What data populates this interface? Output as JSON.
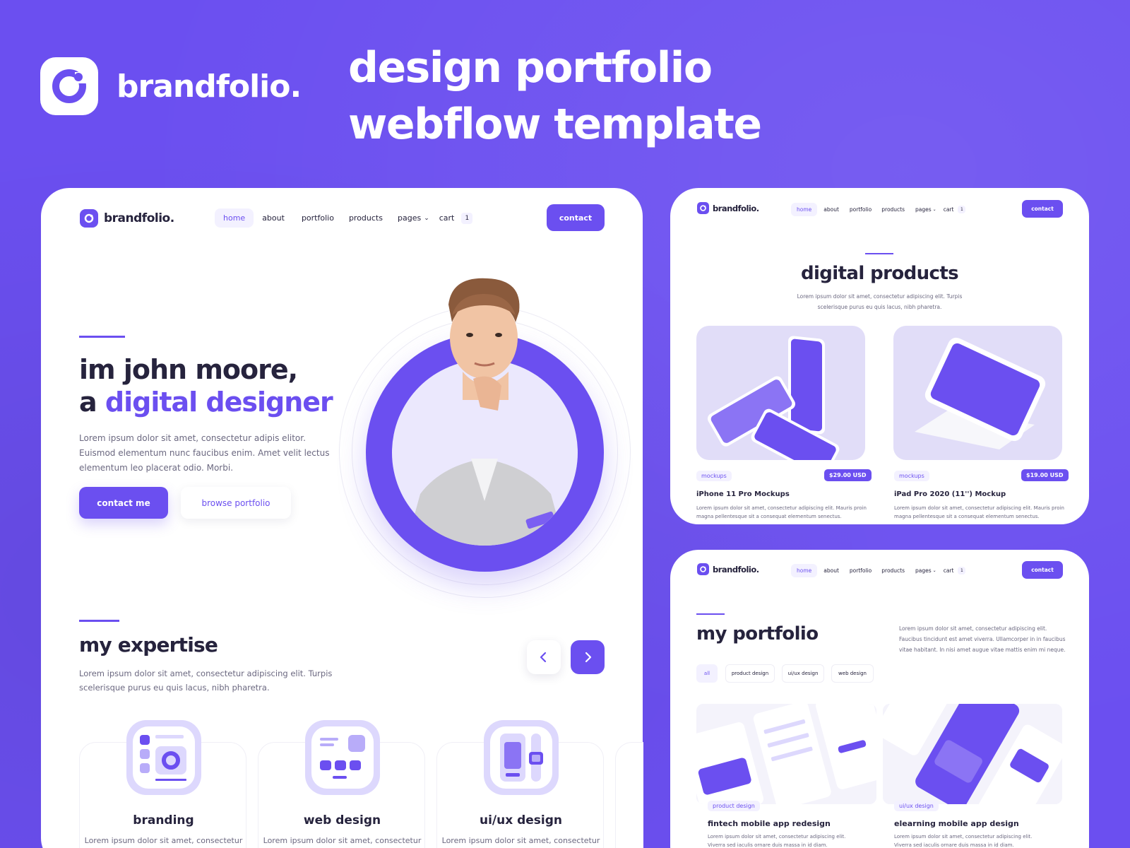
{
  "banner": {
    "brand": "brandfolio.",
    "headline_line1": "design portfolio",
    "headline_line2": "webflow template"
  },
  "nav": {
    "logo": "brandfolio.",
    "links": [
      "home",
      "about",
      "portfolio",
      "products",
      "pages",
      "cart"
    ],
    "cart_count": "1",
    "contact": "contact"
  },
  "hero": {
    "title_line1": "im john moore,",
    "title_prefix": "a",
    "title_highlight": "digital designer",
    "desc_line1": "Lorem ipsum dolor sit amet, consectetur adipis elitor.",
    "desc_line2": "Euismod elementum nunc faucibus enim. Amet velit lectus",
    "desc_line3": "elementum leo placerat odio. Morbi.",
    "primary_button": "contact me",
    "secondary_button": "browse portfolio"
  },
  "expertise": {
    "title": "my expertise",
    "desc_line1": "Lorem ipsum dolor sit amet, consectetur adipiscing elit. Turpis",
    "desc_line2": "scelerisque purus eu quis lacus, nibh pharetra.",
    "services": [
      {
        "title": "branding",
        "text": "Lorem ipsum dolor sit amet, consectetur"
      },
      {
        "title": "web design",
        "text": "Lorem ipsum dolor sit amet, consectetur"
      },
      {
        "title": "ui/ux design",
        "text": "Lorem ipsum dolor sit amet, consectetur"
      }
    ]
  },
  "products_page": {
    "title": "digital products",
    "desc_line1": "Lorem ipsum dolor sit amet, consectetur adipiscing elit. Turpis",
    "desc_line2": "scelerisque purus eu quis lacus, nibh pharetra.",
    "items": [
      {
        "tag": "mockups",
        "price": "$29.00 USD",
        "title": "iPhone 11 Pro Mockups",
        "text_line1": "Lorem ipsum dolor sit amet, consectetur adipiscing elit. Mauris proin",
        "text_line2": "magna pellentesque sit a consequat elementum senectus."
      },
      {
        "tag": "mockups",
        "price": "$19.00 USD",
        "title": "iPad Pro 2020 (11'') Mockup",
        "text_line1": "Lorem ipsum dolor sit amet, consectetur adipiscing elit. Mauris proin",
        "text_line2": "magna pellentesque sit a consequat elementum senectus."
      }
    ]
  },
  "portfolio_page": {
    "title": "my portfolio",
    "desc_line1": "Lorem ipsum dolor sit amet, consectetur adipiscing elit.",
    "desc_line2": "Faucibus tincidunt est amet viverra. Ullamcorper in in faucibus",
    "desc_line3": "vitae habitant. In nisi amet augue vitae mattis enim mi neque.",
    "filters": [
      "all",
      "product design",
      "ui/ux design",
      "web design"
    ],
    "items": [
      {
        "tag": "product design",
        "title": "fintech mobile app redesign",
        "text_line1": "Lorem ipsum dolor sit amet, consectetur adipiscing elit.",
        "text_line2": "Viverra sed iaculis ornare duis massa in id diam."
      },
      {
        "tag": "ui/ux design",
        "title": "elearning mobile app design",
        "text_line1": "Lorem ipsum dolor sit amet, consectetur adipiscing elit.",
        "text_line2": "Viverra sed iaculis ornare duis massa in id diam."
      }
    ]
  },
  "colors": {
    "brand": "#6b4ff0",
    "text": "#26233d",
    "muted": "#6b6880",
    "soft": "#f3f1ff"
  }
}
